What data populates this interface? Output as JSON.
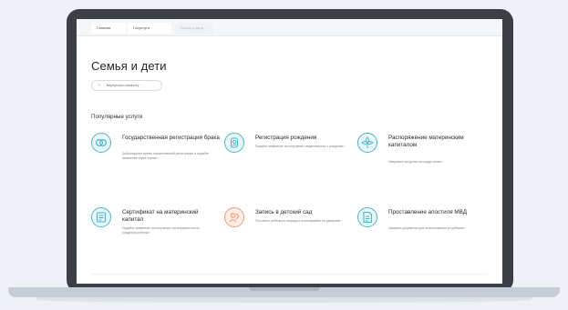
{
  "browser": {
    "tabs": [
      {
        "label": "Главная"
      },
      {
        "label": "Госуслуги"
      },
      {
        "label": "Семья и дети"
      }
    ]
  },
  "page": {
    "title": "Семья и дети",
    "back_label": "Вернуться к каталогу",
    "section_title": "Популярные услуги"
  },
  "services": [
    {
      "title": "Государственная регистрация брака",
      "description": "Забронируйте время торжественной регистрации и подайте заявление через портал",
      "icon": "rings-icon"
    },
    {
      "title": "Регистрация рождения",
      "description": "Подайте заявление на получение свидетельства о рождении",
      "icon": "baby-icon"
    },
    {
      "title": "Распоряжение материнским капиталом",
      "description": "Направьте средства на нужды семьи",
      "icon": "flower-icon"
    },
    {
      "title": "Сертификат на материнский капитал",
      "description": "Подайте заявление на получение сертификата после рождения ребенка",
      "icon": "certificate-icon"
    },
    {
      "title": "Запись в детский сад",
      "description": "Поставьте ребенка в очередь и отслеживайте ее движение",
      "icon": "kindergarten-icon"
    },
    {
      "title": "Проставление апостиля МВД",
      "description": "Заверьте документы для использования за рубежом",
      "icon": "document-icon"
    }
  ],
  "colors": {
    "accent": "#4cb6c9",
    "accent_orange": "#f09a72",
    "text": "#1e2329",
    "muted": "#7b828d",
    "laptop": "#3c4046"
  }
}
